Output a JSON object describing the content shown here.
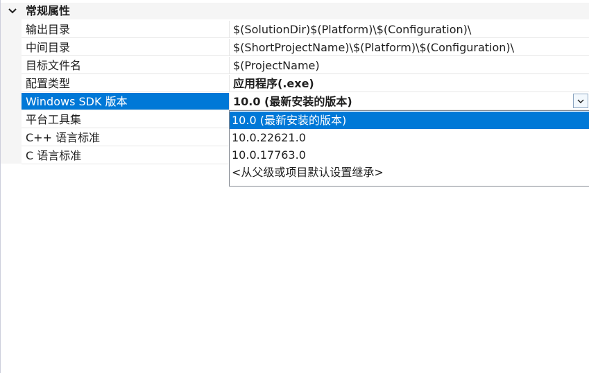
{
  "category": {
    "label": "常规属性",
    "chevron_icon": "chevron-down-icon"
  },
  "properties": [
    {
      "name": "输出目录",
      "value": "$(SolutionDir)$(Platform)\\$(Configuration)\\",
      "bold": false
    },
    {
      "name": "中间目录",
      "value": "$(ShortProjectName)\\$(Platform)\\$(Configuration)\\",
      "bold": false
    },
    {
      "name": "目标文件名",
      "value": "$(ProjectName)",
      "bold": false
    },
    {
      "name": "配置类型",
      "value": "应用程序(.exe)",
      "bold": true
    },
    {
      "name": "Windows SDK 版本",
      "value": "10.0 (最新安装的版本)",
      "bold": true,
      "selected": true
    },
    {
      "name": "平台工具集",
      "value": "",
      "bold": false
    },
    {
      "name": "C++ 语言标准",
      "value": "",
      "bold": false
    },
    {
      "name": "C 语言标准",
      "value": "",
      "bold": false
    }
  ],
  "dropdown": {
    "button_icon": "chevron-down-icon",
    "options": [
      {
        "label": "10.0 (最新安装的版本)",
        "selected": true
      },
      {
        "label": "10.0.22621.0",
        "selected": false
      },
      {
        "label": "10.0.17763.0",
        "selected": false
      },
      {
        "label": "<从父级或项目默认设置继承>",
        "selected": false
      }
    ]
  },
  "colors": {
    "selection": "#0078d7",
    "category_background": "#f5f5f5"
  }
}
